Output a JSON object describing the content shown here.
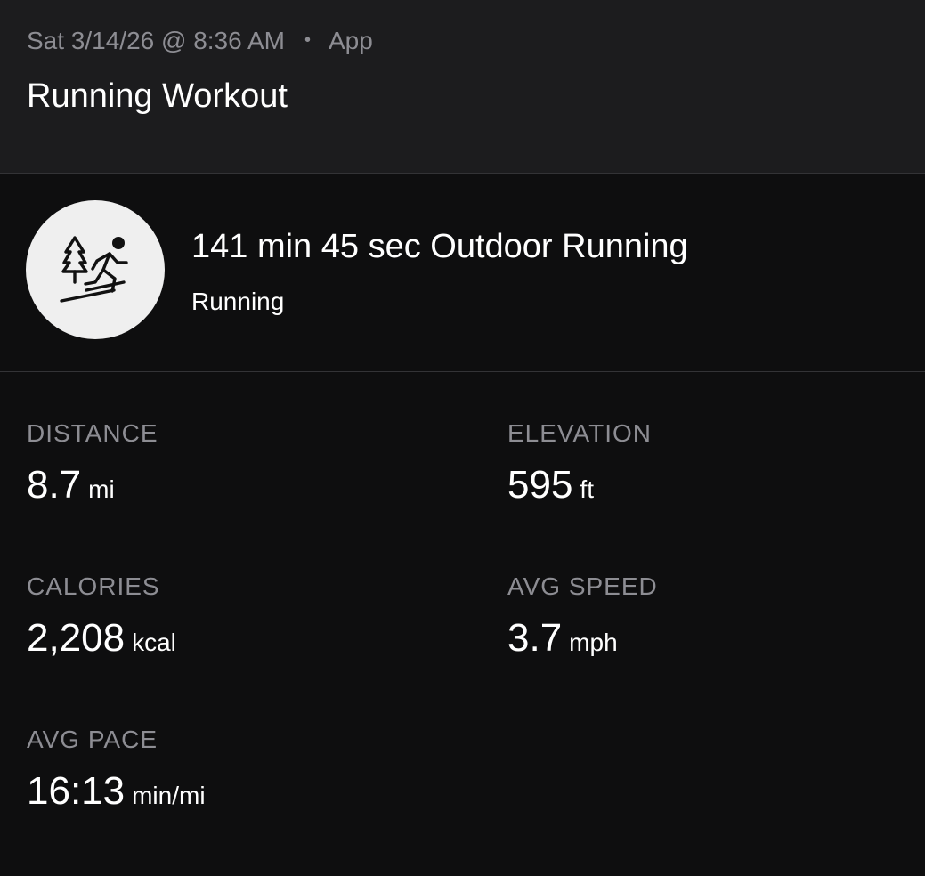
{
  "header": {
    "datetime": "Sat 3/14/26 @ 8:36 AM",
    "separator": "•",
    "source": "App",
    "title": "Running Workout"
  },
  "summary": {
    "icon": "outdoor-running-icon",
    "title": "141 min 45 sec Outdoor Running",
    "subtitle": "Running"
  },
  "stats": [
    {
      "label": "DISTANCE",
      "value": "8.7",
      "unit": "mi"
    },
    {
      "label": "ELEVATION",
      "value": "595",
      "unit": "ft"
    },
    {
      "label": "CALORIES",
      "value": "2,208",
      "unit": "kcal"
    },
    {
      "label": "AVG SPEED",
      "value": "3.7",
      "unit": "mph"
    },
    {
      "label": "AVG PACE",
      "value": "16:13",
      "unit": "min/mi"
    }
  ],
  "colors": {
    "header_bg": "#1c1c1e",
    "page_bg": "#0e0e0f",
    "muted_text": "#8d8d93",
    "icon_bg": "#efefef"
  }
}
